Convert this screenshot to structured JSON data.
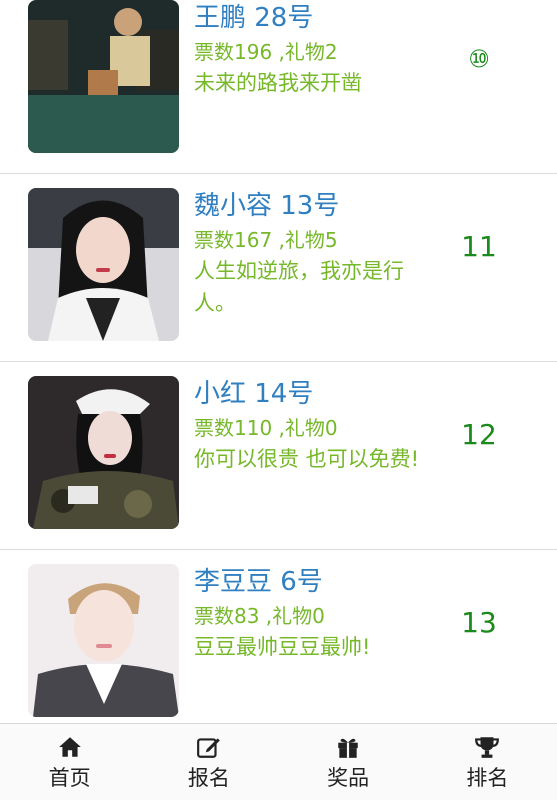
{
  "contestants": [
    {
      "name": "王鹏 28号",
      "stats": "票数196 ,礼物2",
      "motto": "未来的路我来开凿",
      "rank": "⑩"
    },
    {
      "name": "魏小容 13号",
      "stats": "票数167 ,礼物5",
      "motto": "人生如逆旅，我亦是行人。",
      "rank": "11"
    },
    {
      "name": "小红 14号",
      "stats": "票数110 ,礼物0",
      "motto": "你可以很贵 也可以免费!",
      "rank": "12"
    },
    {
      "name": "李豆豆 6号",
      "stats": "票数83 ,礼物0",
      "motto": "豆豆最帅豆豆最帅!",
      "rank": "13"
    }
  ],
  "tabbar": [
    {
      "label": "首页",
      "icon": "home-icon"
    },
    {
      "label": "报名",
      "icon": "edit-icon"
    },
    {
      "label": "奖品",
      "icon": "gift-icon"
    },
    {
      "label": "排名",
      "icon": "trophy-icon"
    }
  ]
}
